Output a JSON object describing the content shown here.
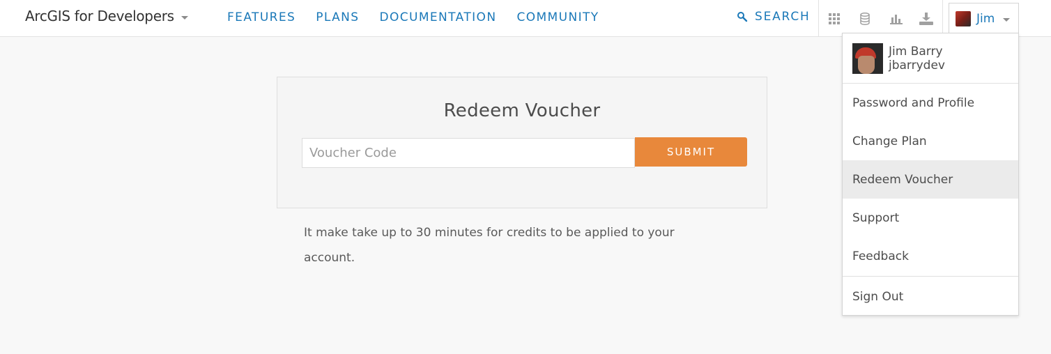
{
  "header": {
    "brand": "ArcGIS for Developers",
    "nav": [
      "FEATURES",
      "PLANS",
      "DOCUMENTATION",
      "COMMUNITY"
    ],
    "search_label": "SEARCH",
    "icons": [
      "grid-icon",
      "database-icon",
      "bar-chart-icon",
      "download-icon"
    ],
    "user_name": "Jim"
  },
  "dropdown": {
    "full_name": "Jim Barry",
    "username": "jbarrydev",
    "items": [
      "Password and Profile",
      "Change Plan",
      "Redeem Voucher",
      "Support",
      "Feedback"
    ],
    "active_item": "Redeem Voucher",
    "sign_out": "Sign Out"
  },
  "voucher": {
    "title": "Redeem Voucher",
    "placeholder": "Voucher Code",
    "submit_label": "SUBMIT",
    "note": "It make take up to 30 minutes for credits to be applied to your account."
  },
  "colors": {
    "link": "#1a78b8",
    "accent": "#e8883b",
    "background": "#f8f8f8"
  }
}
